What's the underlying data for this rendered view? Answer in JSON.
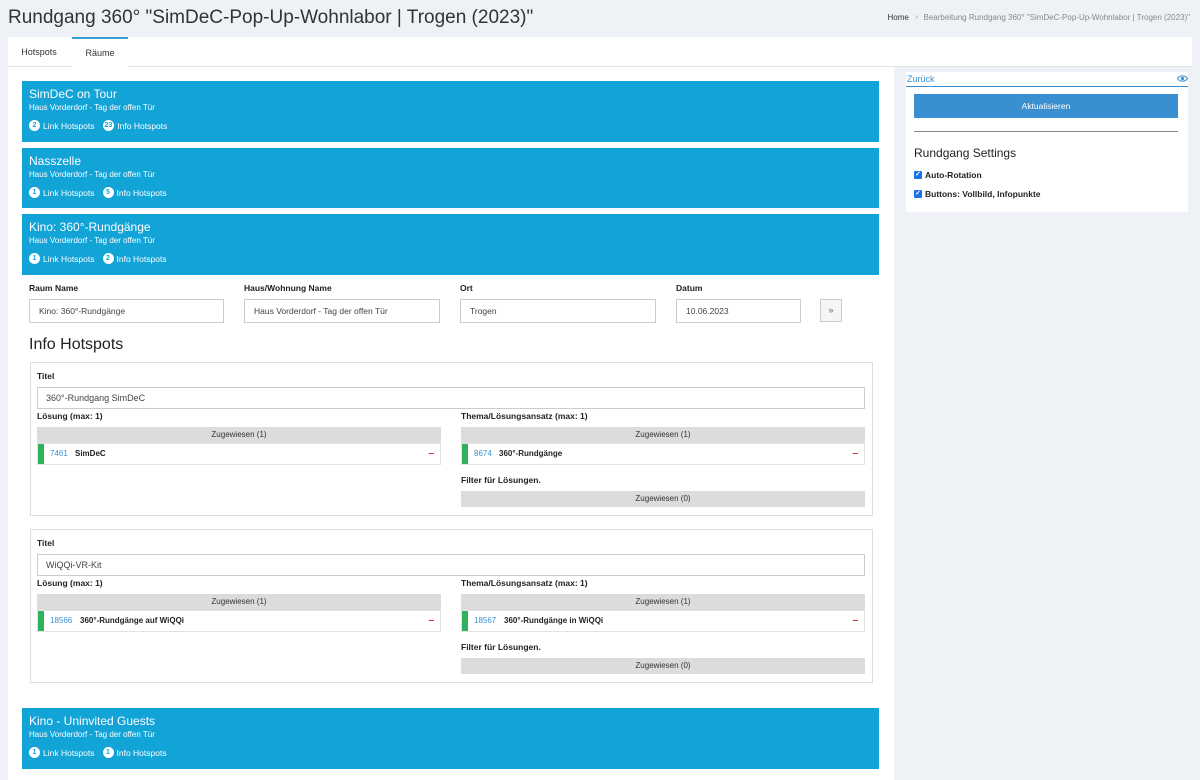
{
  "page": {
    "title": "Rundgang 360° \"SimDeC-Pop-Up-Wohnlabor | Trogen (2023)\"",
    "breadcrumb": {
      "home": "Home",
      "current": "Bearbeitung Rundgang 360° \"SimDeC-Pop-Up-Wohnlabor | Trogen (2023)\""
    }
  },
  "tabs": [
    {
      "label": "Hotspots"
    },
    {
      "label": "Räume"
    }
  ],
  "rooms": [
    {
      "title": "SimDeC on Tour",
      "subtitle": "Haus Vorderdorf - Tag der offen Tür",
      "link_count": "2",
      "link_label": "Link Hotspots",
      "info_count": "23",
      "info_label": "Info Hotspots"
    },
    {
      "title": "Nasszelle",
      "subtitle": "Haus Vorderdorf - Tag der offen Tür",
      "link_count": "1",
      "link_label": "Link Hotspots",
      "info_count": "5",
      "info_label": "Info Hotspots"
    },
    {
      "title": "Kino: 360°-Rundgänge",
      "subtitle": "Haus Vorderdorf - Tag der offen Tür",
      "link_count": "1",
      "link_label": "Link Hotspots",
      "info_count": "2",
      "info_label": "Info Hotspots"
    },
    {
      "title": "Kino - Uninvited Guests",
      "subtitle": "Haus Vorderdorf - Tag der offen Tür",
      "link_count": "1",
      "link_label": "Link Hotspots",
      "info_count": "1",
      "info_label": "Info Hotspots"
    }
  ],
  "form": {
    "raum_label": "Raum Name",
    "raum_value": "Kino: 360°-Rundgänge",
    "haus_label": "Haus/Wohnung Name",
    "haus_value": "Haus Vorderdorf - Tag der offen Tür",
    "ort_label": "Ort",
    "ort_value": "Trogen",
    "datum_label": "Datum",
    "datum_value": "10.06.2023",
    "go_label": "»"
  },
  "info_hotspots": {
    "section_title": "Info Hotspots",
    "items": [
      {
        "titel_label": "Titel",
        "titel_value": "360°-Rundgang SimDeC",
        "loesung_label": "Lösung (max: 1)",
        "loesung_assigned": "Zugewiesen (1)",
        "loesung_id": "7461",
        "loesung_name": "SimDeC",
        "thema_label": "Thema/Lösungsansatz (max: 1)",
        "thema_assigned": "Zugewiesen (1)",
        "thema_id": "8674",
        "thema_name": "360°-Rundgänge",
        "filter_label": "Filter für Lösungen.",
        "filter_assigned": "Zugewiesen (0)"
      },
      {
        "titel_label": "Titel",
        "titel_value": "WiQQi-VR-Kit",
        "loesung_label": "Lösung (max: 1)",
        "loesung_assigned": "Zugewiesen (1)",
        "loesung_id": "18566",
        "loesung_name": "360°-Rundgänge auf WiQQi",
        "thema_label": "Thema/Lösungsansatz (max: 1)",
        "thema_assigned": "Zugewiesen (1)",
        "thema_id": "18567",
        "thema_name": "360°-Rundgänge in WiQQi",
        "filter_label": "Filter für Lösungen.",
        "filter_assigned": "Zugewiesen (0)"
      }
    ],
    "remove_symbol": "–"
  },
  "sidebar": {
    "back_label": "Zurück",
    "update_label": "Aktualisieren",
    "settings_title": "Rundgang Settings",
    "checkboxes": [
      {
        "label": "Auto-Rotation",
        "checked": true
      },
      {
        "label": "Buttons: Vollbild, Infopunkte",
        "checked": true
      }
    ]
  },
  "colors": {
    "room_bg": "#12a3d7",
    "accent": "#3a8fd0",
    "assigned_bar": "#2fb15e",
    "remove": "#e02a2a"
  },
  "icons": {
    "back_right": "eye-icon"
  }
}
